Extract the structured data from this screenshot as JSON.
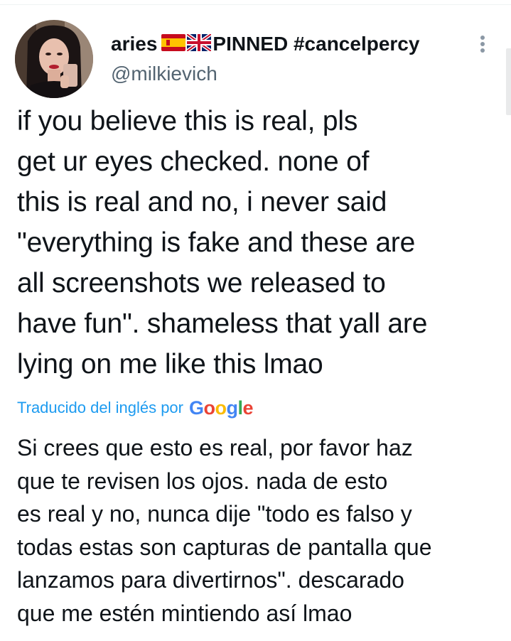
{
  "tweet": {
    "author": {
      "display_name": "aries",
      "flags": [
        "spain-flag-icon",
        "uk-flag-icon"
      ],
      "display_name_suffix": "PINNED #cancelpercy",
      "handle": "@milkievich"
    },
    "text_lines": [
      "if you believe this is real, pls",
      "get ur eyes checked. none of",
      "this is real and no, i never said",
      "\"everything is fake and these are",
      "all screenshots we released to",
      "have fun\". shameless that yall are",
      "lying on me like this lmao"
    ],
    "translation": {
      "label": "Traducido del inglés por",
      "provider": [
        "G",
        "o",
        "o",
        "g",
        "l",
        "e"
      ],
      "lines": [
        "Si crees que esto es real, por favor haz",
        "que te revisen los ojos. nada de esto",
        "es real y no, nunca dije \"todo es falso y",
        "todas estas son capturas de pantalla que",
        "lanzamos para divertirnos\". descarado",
        "que me estén mintiendo así lmao"
      ]
    }
  },
  "colors": {
    "text": "#0f1419",
    "secondary_text": "#536471",
    "link": "#1d9bf0"
  }
}
